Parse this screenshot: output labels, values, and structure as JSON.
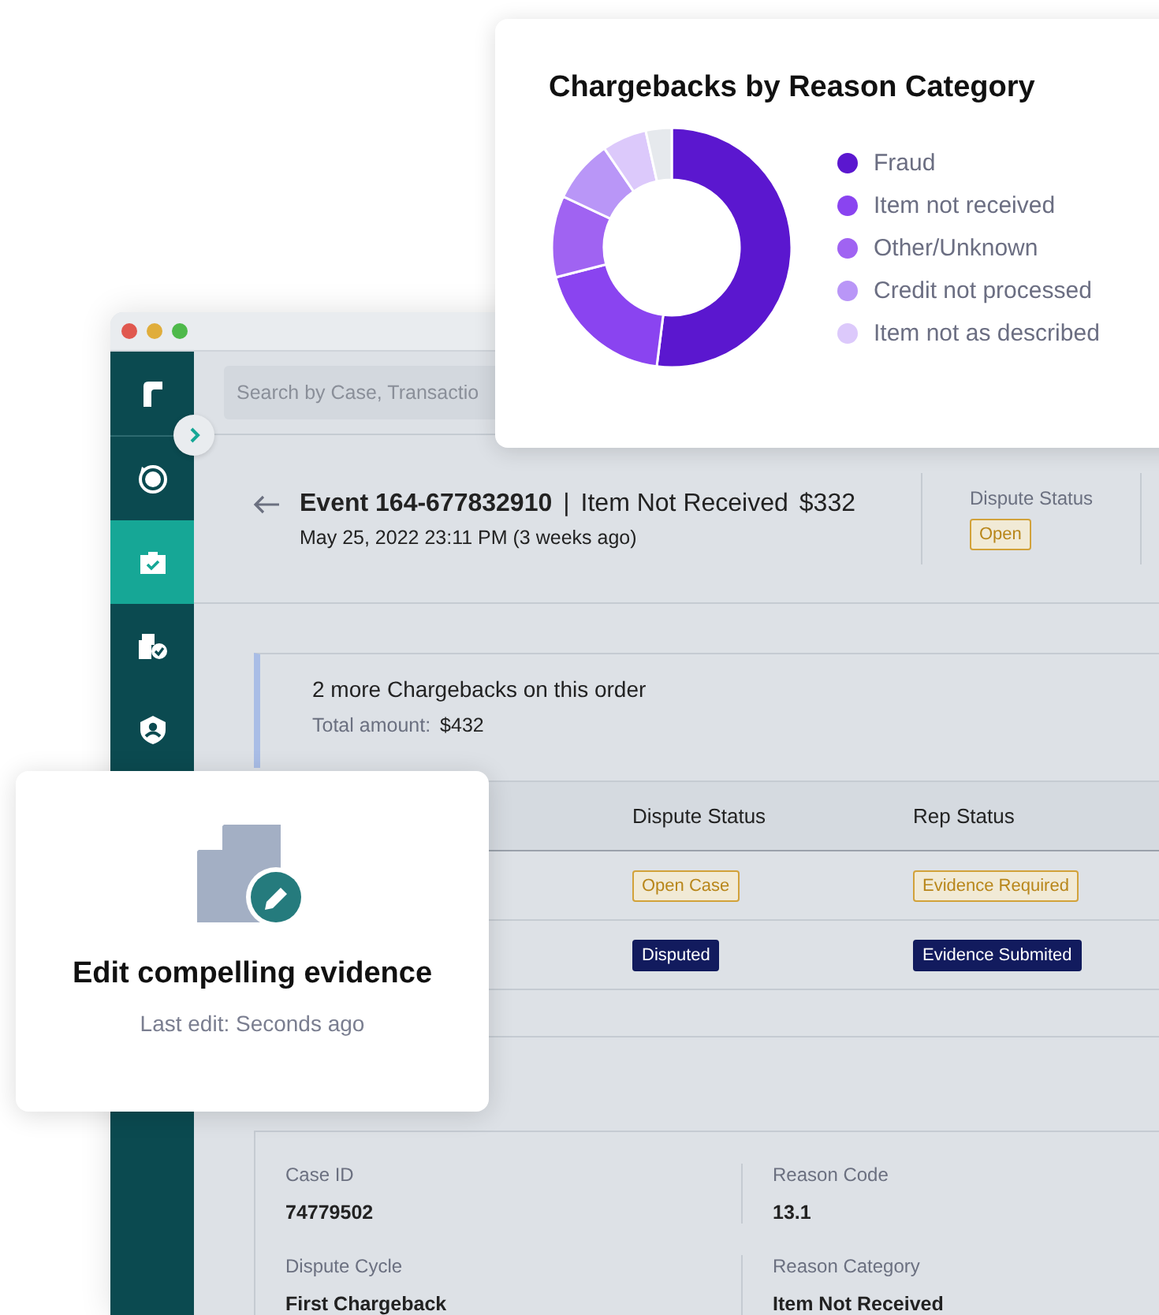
{
  "app_window": {
    "search": {
      "placeholder": "Search by Case, Transactio"
    },
    "sidebar": [
      {
        "kind": "logo",
        "selected": false
      },
      {
        "kind": "dollar",
        "selected": false
      },
      {
        "kind": "briefcase",
        "selected": true
      },
      {
        "kind": "document",
        "selected": false
      },
      {
        "kind": "shield",
        "selected": false
      }
    ],
    "event": {
      "title": "Event 164-677832910",
      "separator": "|",
      "reason": "Item Not Received",
      "amount": "$332",
      "date": "May 25, 2022 23:11 PM (3 weeks ago)",
      "status_label": "Dispute Status",
      "status": {
        "text": "Open",
        "kind": "outline"
      }
    },
    "notice": {
      "title": "2 more Chargebacks on this order",
      "total_label": "Total amount:",
      "total": "$432"
    },
    "table": {
      "columns": [
        "Dispute Status",
        "Rep Status"
      ],
      "rows": [
        [
          {
            "text": "Open Case",
            "kind": "outline"
          },
          {
            "text": "Evidence Required",
            "kind": "outline"
          }
        ],
        [
          {
            "text": "Disputed",
            "kind": "solid"
          },
          {
            "text": "Evidence Submited",
            "kind": "solid"
          }
        ]
      ]
    },
    "details": [
      {
        "label": "Case ID",
        "value": "74779502"
      },
      {
        "label": "Reason Code",
        "value": "13.1"
      },
      {
        "label": "Dispute Cycle",
        "value": "First Chargeback"
      },
      {
        "label": "Reason Category",
        "value": "Item Not Received"
      }
    ]
  },
  "chart_card": {
    "title": "Chargebacks by Reason Category",
    "legend": [
      {
        "label": "Fraud",
        "color": "#5b17cf"
      },
      {
        "label": "Item not received",
        "color": "#8a44f0"
      },
      {
        "label": "Other/Unknown",
        "color": "#a063f2"
      },
      {
        "label": "Credit not processed",
        "color": "#b996f7"
      },
      {
        "label": "Item not as described",
        "color": "#dcc9fb"
      }
    ]
  },
  "evidence_card": {
    "title": "Edit compelling evidence",
    "subtitle": "Last edit: Seconds ago"
  }
}
